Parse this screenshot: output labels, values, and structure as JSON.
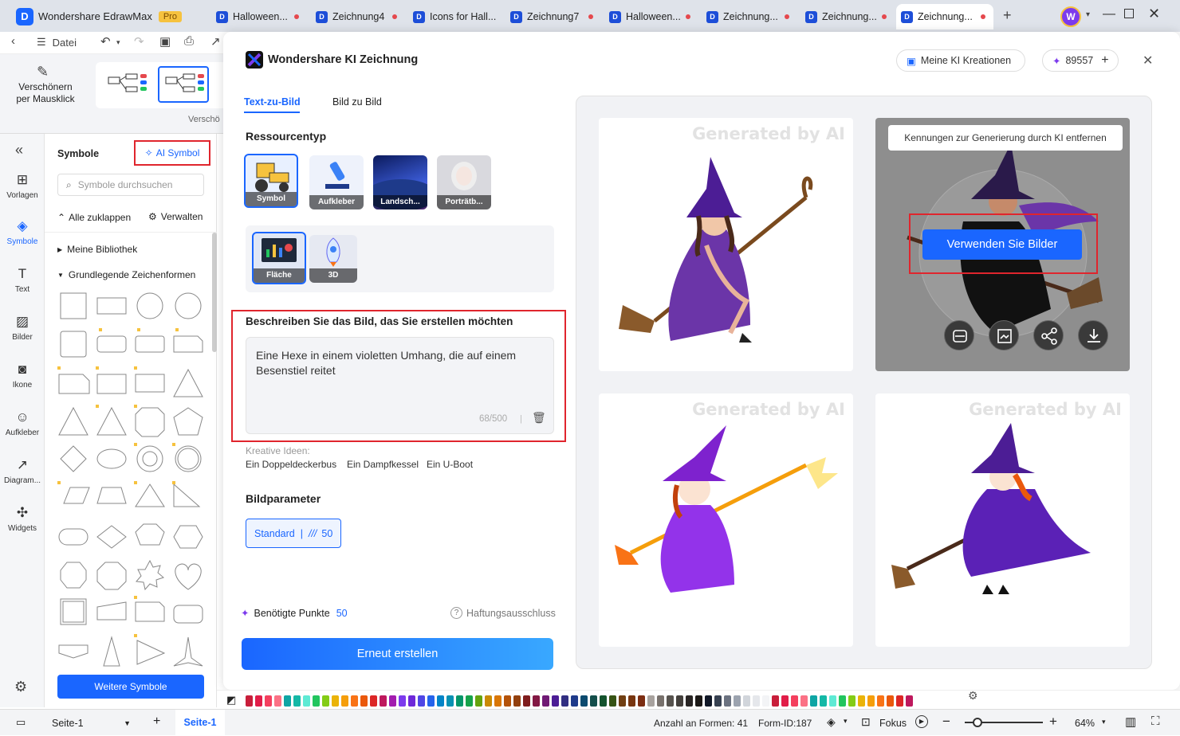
{
  "app": {
    "title": "Wondershare EdrawMax",
    "badge": "Pro"
  },
  "tabs": [
    {
      "label": "Halloween..."
    },
    {
      "label": "Zeichnung4"
    },
    {
      "label": "Icons for Hall..."
    },
    {
      "label": "Zeichnung7"
    },
    {
      "label": "Halloween..."
    },
    {
      "label": "Zeichnung..."
    },
    {
      "label": "Zeichnung..."
    },
    {
      "label": "Zeichnung..."
    }
  ],
  "user": {
    "avatar": "W"
  },
  "toolbar": {
    "file_label": "Datei"
  },
  "ribbon": {
    "beautify_label": "Verschönern per Mausklick",
    "section_label": "Verschö"
  },
  "iconbar": [
    {
      "label": "Vorlagen",
      "icon": "template-icon"
    },
    {
      "label": "Symbole",
      "icon": "symbols-icon"
    },
    {
      "label": "Text",
      "icon": "text-icon"
    },
    {
      "label": "Bilder",
      "icon": "image-icon"
    },
    {
      "label": "Ikone",
      "icon": "icon-icon"
    },
    {
      "label": "Aufkleber",
      "icon": "sticker-icon"
    },
    {
      "label": "Diagram...",
      "icon": "chart-icon"
    },
    {
      "label": "Widgets",
      "icon": "widgets-icon"
    }
  ],
  "symbols": {
    "title": "Symbole",
    "ai_label": "AI Symbol",
    "search_placeholder": "Symbole durchsuchen",
    "collapse_label": "Alle zuklappen",
    "manage_label": "Verwalten",
    "library_label": "Meine Bibliothek",
    "basic_label": "Grundlegende Zeichenformen",
    "more_button": "Weitere Symbole"
  },
  "modal": {
    "title": "Wondershare KI Zeichnung",
    "my_creations": "Meine KI Kreationen",
    "points": "89557",
    "tab_text": "Text-zu-Bild",
    "tab_image": "Bild zu Bild",
    "resource_title": "Ressourcentyp",
    "resource_types": [
      {
        "label": "Symbol"
      },
      {
        "label": "Aufkleber"
      },
      {
        "label": "Landsch..."
      },
      {
        "label": "Porträtb..."
      }
    ],
    "sub_types": [
      {
        "label": "Fläche"
      },
      {
        "label": "3D"
      }
    ],
    "describe_title": "Beschreiben Sie das Bild, das Sie erstellen möchten",
    "prompt": "Eine Hexe in einem violetten Umhang, die auf einem Besenstiel reitet",
    "counter": "68/500",
    "ideas_label": "Kreative Ideen:",
    "ideas": [
      "Ein Doppeldeckerbus",
      "Ein Dampfkessel",
      "Ein U-Boot"
    ],
    "params_title": "Bildparameter",
    "param_standard": "Standard",
    "param_value": "50",
    "needed_label": "Benötigte Punkte",
    "needed_value": "50",
    "disclaimer": "Haftungsausschluss",
    "regenerate": "Erneut erstellen",
    "watermark": "Generated by AI",
    "remove_id": "Kennungen zur Generierung durch KI entfernen",
    "use_images": "Verwenden Sie Bilder"
  },
  "status": {
    "page_select": "Seite-1",
    "page_tab": "Seite-1",
    "shapes": "Anzahl an Formen: 41",
    "form_id": "Form-ID:187",
    "focus": "Fokus",
    "zoom": "64%"
  },
  "colors": {
    "accent": "#1a66ff",
    "highlight": "#e0252d",
    "purple": "#6b35a8"
  }
}
